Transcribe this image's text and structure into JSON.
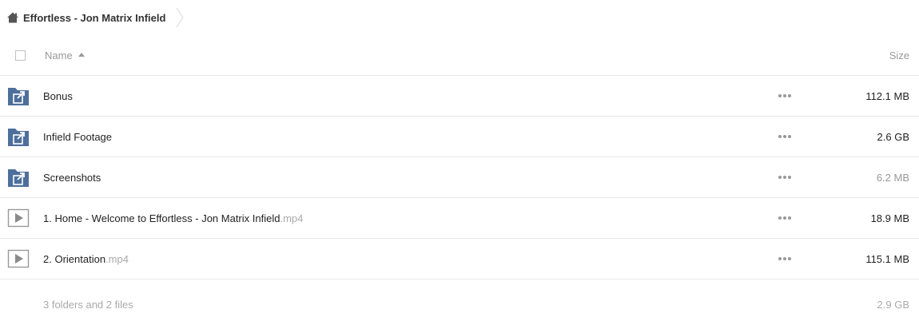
{
  "breadcrumb": {
    "home_icon": "home-icon",
    "current": "Effortless - Jon Matrix Infield"
  },
  "table": {
    "header": {
      "name_label": "Name",
      "size_label": "Size",
      "sort": "name-ascending"
    },
    "rows": [
      {
        "kind": "shared-folder",
        "icon": "shared-folder-icon",
        "name": "Bonus",
        "ext": "",
        "size": "112.1 MB"
      },
      {
        "kind": "shared-folder",
        "icon": "shared-folder-icon",
        "name": "Infield Footage",
        "ext": "",
        "size": "2.6 GB"
      },
      {
        "kind": "shared-folder",
        "icon": "shared-folder-icon",
        "name": "Screenshots",
        "ext": "",
        "size": "6.2 MB"
      },
      {
        "kind": "video",
        "icon": "video-play-icon",
        "name": "1. Home - Welcome to Effortless - Jon Matrix Infield",
        "ext": ".mp4",
        "size": "18.9 MB"
      },
      {
        "kind": "video",
        "icon": "video-play-icon",
        "name": "2. Orientation",
        "ext": ".mp4",
        "size": "115.1 MB"
      }
    ],
    "footer": {
      "summary": "3 folders and 2 files",
      "total_size": "2.9 GB"
    }
  },
  "colors": {
    "folder": "#4e6f9b",
    "muted_text": "#999999",
    "divider": "#e8e8e8"
  }
}
